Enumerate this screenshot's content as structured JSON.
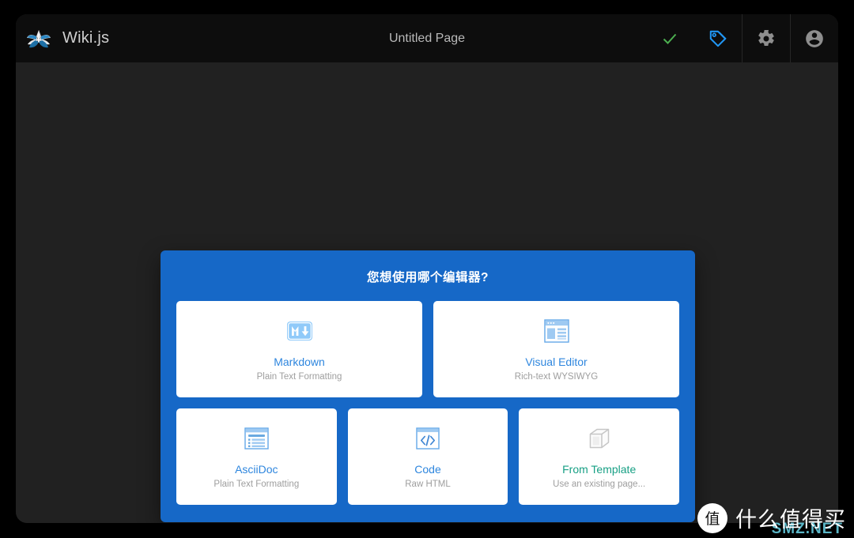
{
  "window": {
    "header": {
      "brand_name": "Wiki.js",
      "brand_logo_icon": "wikijs-butterfly-logo",
      "page_title": "Untitled Page",
      "actions": [
        {
          "name": "save-button",
          "icon": "check-icon",
          "color": "#4caf50"
        },
        {
          "name": "properties-button",
          "icon": "tag-icon",
          "color": "#2196f3"
        },
        {
          "name": "settings-button",
          "icon": "gear-icon",
          "color": "#9e9e9e"
        },
        {
          "name": "account-button",
          "icon": "account-circle-icon",
          "color": "#9e9e9e"
        }
      ]
    },
    "dialog": {
      "title": "您想使用哪个编辑器?",
      "accent_color": "#1668c7",
      "rows": [
        [
          {
            "key": "markdown",
            "icon": "markdown-icon",
            "label": "Markdown",
            "sublabel": "Plain Text Formatting",
            "label_color": "#2e86de"
          },
          {
            "key": "visual-editor",
            "icon": "visual-editor-window-icon",
            "label": "Visual Editor",
            "sublabel": "Rich-text WYSIWYG",
            "label_color": "#2e86de"
          }
        ],
        [
          {
            "key": "asciidoc",
            "icon": "asciidoc-document-icon",
            "label": "AsciiDoc",
            "sublabel": "Plain Text Formatting",
            "label_color": "#2e86de"
          },
          {
            "key": "code",
            "icon": "code-brackets-icon",
            "label": "Code",
            "sublabel": "Raw HTML",
            "label_color": "#2e86de"
          },
          {
            "key": "from-template",
            "icon": "cube-icon",
            "label": "From Template",
            "sublabel": "Use an existing page...",
            "label_color": "#18a085"
          }
        ]
      ]
    },
    "watermark": {
      "badge": "值",
      "text": "什么值得买",
      "url": "SMZ.NET"
    }
  }
}
